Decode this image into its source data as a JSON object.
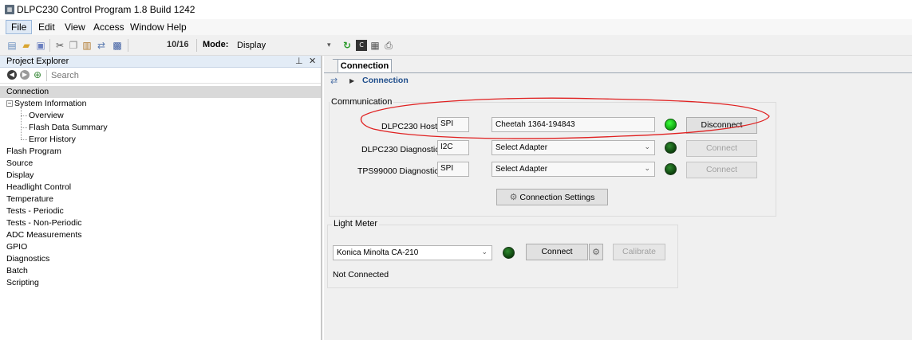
{
  "window": {
    "title": "DLPC230 Control Program 1.8 Build 1242"
  },
  "menu": [
    "File",
    "Edit",
    "View",
    "Access",
    "Window",
    "Help"
  ],
  "toolbar": {
    "icons": [
      "new-icon",
      "open-icon",
      "save-icon",
      "cut-icon",
      "copy-icon",
      "paste-icon",
      "connection-icon",
      "clear-icon"
    ],
    "page_counter": "10/16",
    "mode_label": "Mode:",
    "mode_value": "Display",
    "extra_icons": [
      "refresh-icon",
      "console-icon",
      "register-icon",
      "script-icon"
    ]
  },
  "explorer": {
    "title": "Project Explorer",
    "pin": "⊥",
    "close": "✕",
    "search_placeholder": "Search",
    "tree": [
      {
        "label": "Connection",
        "level": 0,
        "selected": true
      },
      {
        "label": "System Information",
        "level": 0,
        "expander": "⊟"
      },
      {
        "label": "Overview",
        "level": 1
      },
      {
        "label": "Flash Data Summary",
        "level": 1
      },
      {
        "label": "Error History",
        "level": 1
      },
      {
        "label": "Flash Program",
        "level": 0
      },
      {
        "label": "Source",
        "level": 0
      },
      {
        "label": "Display",
        "level": 0
      },
      {
        "label": "Headlight Control",
        "level": 0
      },
      {
        "label": "Temperature",
        "level": 0
      },
      {
        "label": "Tests - Periodic",
        "level": 0
      },
      {
        "label": "Tests - Non-Periodic",
        "level": 0
      },
      {
        "label": "ADC Measurements",
        "level": 0
      },
      {
        "label": "GPIO",
        "level": 0
      },
      {
        "label": "Diagnostics",
        "level": 0
      },
      {
        "label": "Batch",
        "level": 0
      },
      {
        "label": "Scripting",
        "level": 0
      }
    ]
  },
  "main": {
    "tab": "Connection",
    "breadcrumb": "Connection",
    "communication": {
      "legend": "Communication",
      "rows": [
        {
          "label": "DLPC230 Host",
          "protocol": "SPI",
          "adapter": "Cheetah 1364-194843",
          "led_on": true,
          "button": "Disconnect",
          "button_enabled": true,
          "dropdown": false
        },
        {
          "label": "DLPC230 Diagnostics",
          "protocol": "I2C",
          "adapter": "Select Adapter",
          "led_on": false,
          "button": "Connect",
          "button_enabled": false,
          "dropdown": true
        },
        {
          "label": "TPS99000 Diagnostics",
          "protocol": "SPI",
          "adapter": "Select Adapter",
          "led_on": false,
          "button": "Connect",
          "button_enabled": false,
          "dropdown": true
        }
      ],
      "settings_button": "Connection Settings"
    },
    "light_meter": {
      "legend": "Light Meter",
      "device": "Konica Minolta CA-210",
      "connect_button": "Connect",
      "calibrate_button": "Calibrate",
      "status": "Not Connected"
    }
  },
  "colors": {
    "annotation": "#e02020",
    "led_on": "#22dd22",
    "led_off": "#0f4f0f",
    "breadcrumb": "#1f4e8c"
  }
}
